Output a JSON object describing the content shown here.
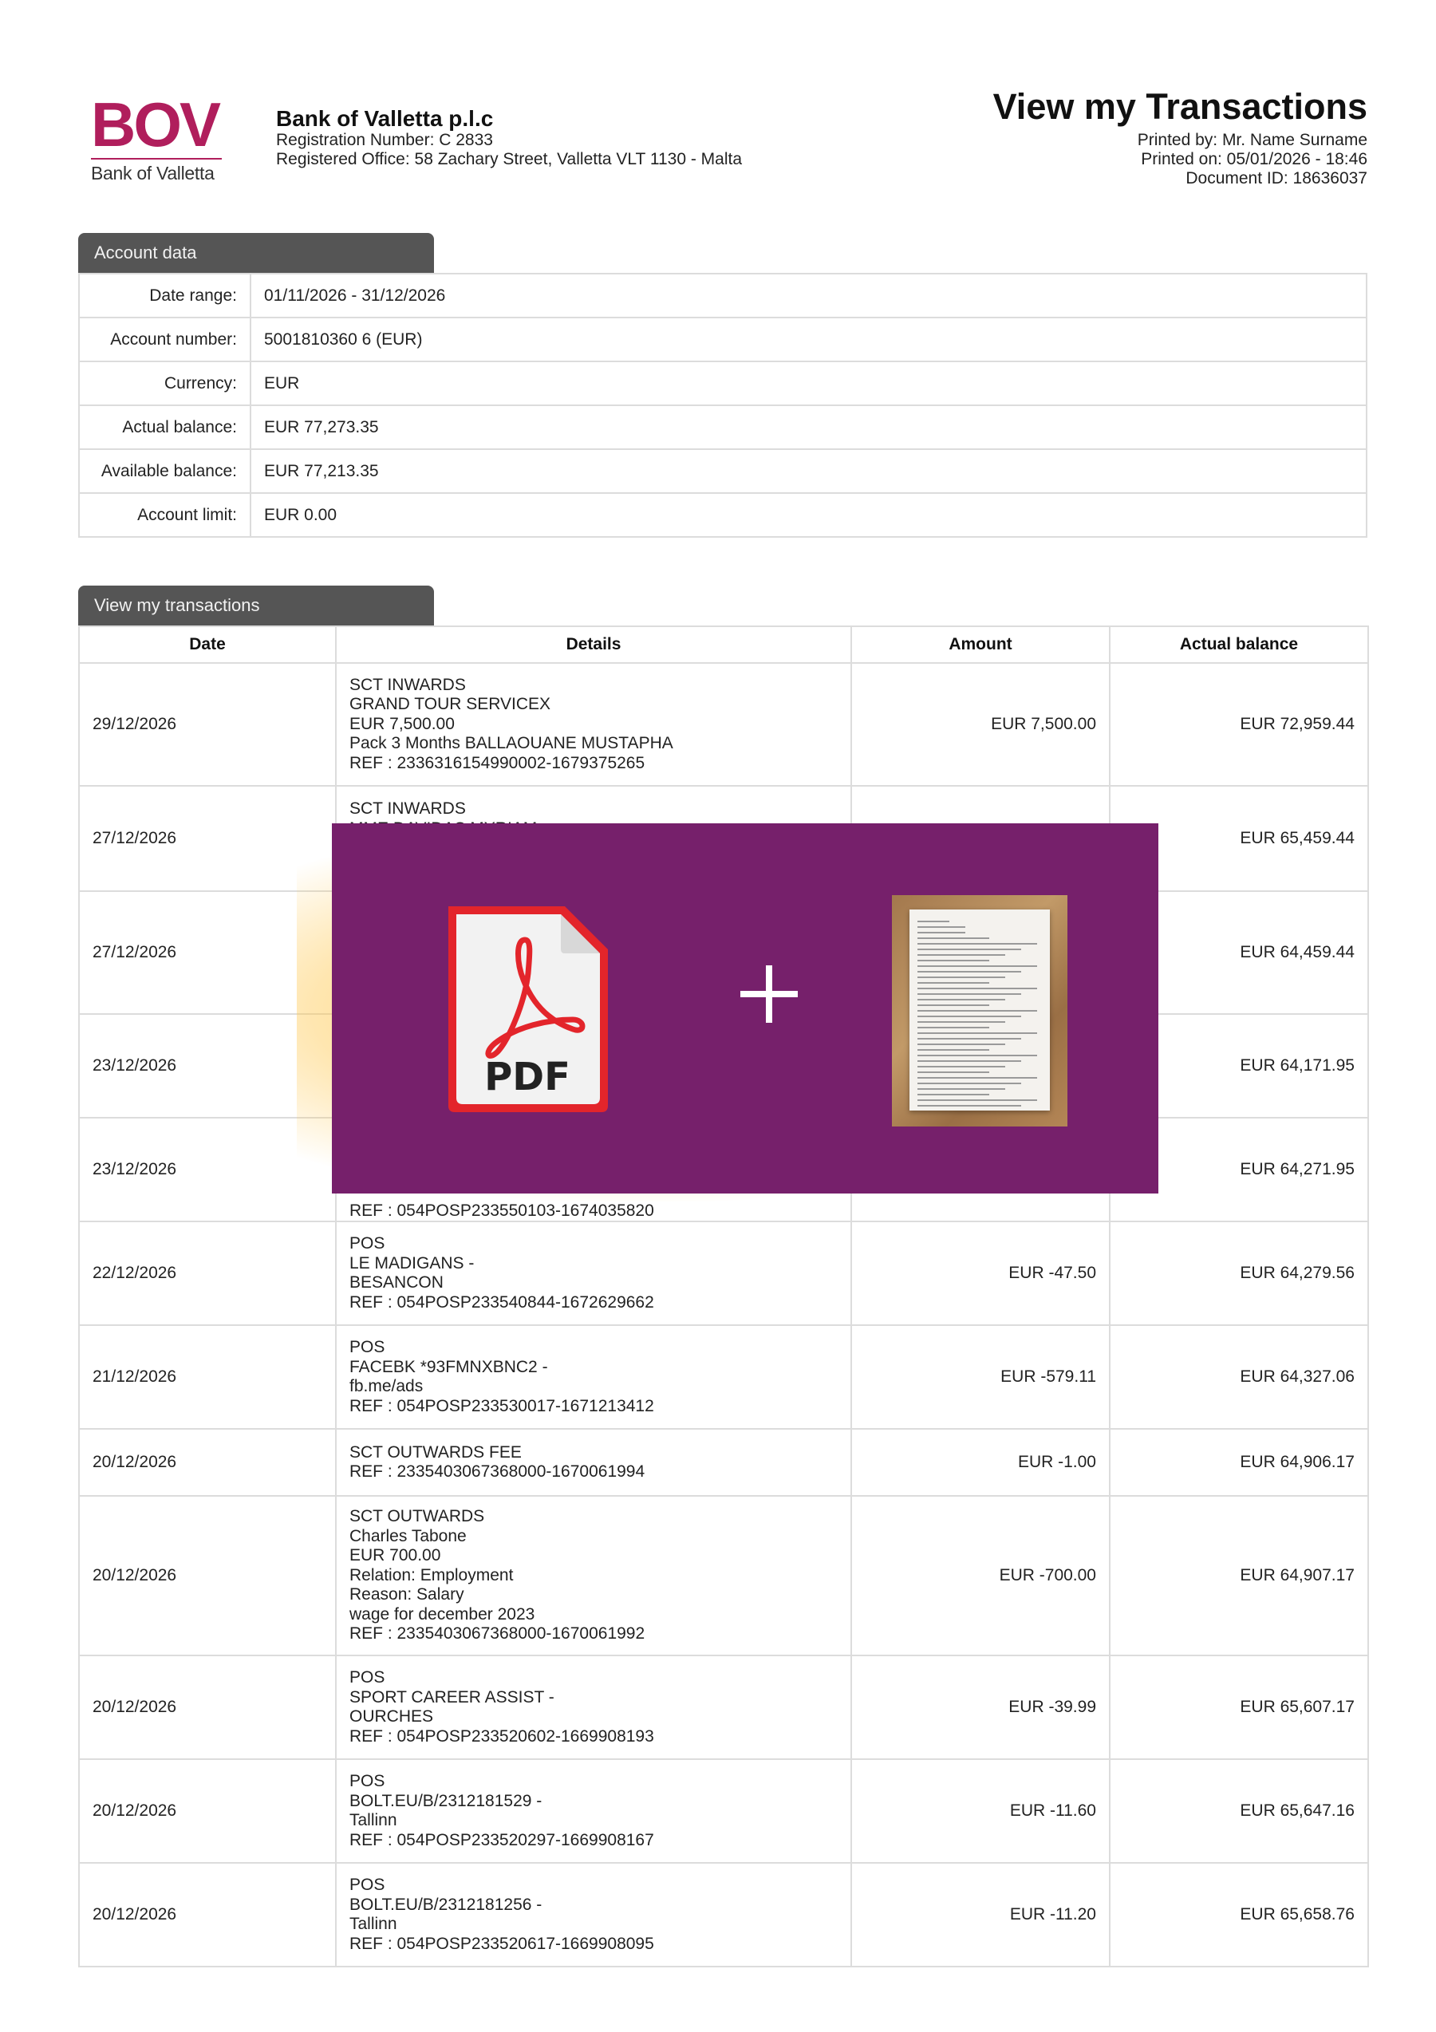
{
  "header": {
    "logo_text": "BOV",
    "logo_subtitle": "Bank of Valletta",
    "bank_name": "Bank of Valletta p.l.c",
    "registration": "Registration Number: C 2833",
    "office": "Registered Office: 58 Zachary Street, Valletta VLT 1130 - Malta",
    "title": "View my Transactions",
    "printed_by": "Printed by: Mr. Name Surname",
    "printed_on": "Printed on: 05/01/2026 - 18:46",
    "document_id": "Document ID: 18636037"
  },
  "account": {
    "tab_label": "Account data",
    "rows": [
      {
        "label": "Date range:",
        "value": "01/11/2026 - 31/12/2026"
      },
      {
        "label": "Account number:",
        "value": "5001810360 6 (EUR)"
      },
      {
        "label": "Currency:",
        "value": "EUR"
      },
      {
        "label": "Actual balance:",
        "value": "EUR 77,273.35"
      },
      {
        "label": "Available balance:",
        "value": "EUR 77,213.35"
      },
      {
        "label": "Account limit:",
        "value": "EUR 0.00"
      }
    ]
  },
  "transactions": {
    "tab_label": "View my transactions",
    "headers": {
      "date": "Date",
      "details": "Details",
      "amount": "Amount",
      "balance": "Actual balance"
    },
    "rows": [
      {
        "date": "29/12/2026",
        "details": [
          "SCT INWARDS",
          "GRAND TOUR SERVICEX",
          "EUR 7,500.00",
          "Pack 3 Months BALLAOUANE MUSTAPHA",
          "REF : 2336316154990002-1679375265"
        ],
        "amount": "EUR 7,500.00",
        "balance": "EUR 72,959.44"
      },
      {
        "date": "27/12/2026",
        "details": [
          "SCT INWARDS",
          "MME DAVIDAS MYRIAM"
        ],
        "amount": "",
        "balance": "EUR 65,459.44"
      },
      {
        "date": "27/12/2026",
        "details": [],
        "amount": "",
        "balance": "EUR 64,459.44"
      },
      {
        "date": "23/12/2026",
        "details": [],
        "amount": "",
        "balance": "EUR 64,171.95"
      },
      {
        "date": "23/12/2026",
        "details": [
          "REF : 054POSP233550103-1674035820"
        ],
        "amount": "",
        "balance": "EUR 64,271.95"
      },
      {
        "date": "22/12/2026",
        "details": [
          "POS",
          "LE MADIGANS -",
          "BESANCON",
          "REF : 054POSP233540844-1672629662"
        ],
        "amount": "EUR -47.50",
        "balance": "EUR 64,279.56"
      },
      {
        "date": "21/12/2026",
        "details": [
          "POS",
          "FACEBK *93FMNXBNC2 -",
          "fb.me/ads",
          "REF : 054POSP233530017-1671213412"
        ],
        "amount": "EUR -579.11",
        "balance": "EUR 64,327.06"
      },
      {
        "date": "20/12/2026",
        "details": [
          "SCT OUTWARDS FEE",
          "REF : 2335403067368000-1670061994"
        ],
        "amount": "EUR -1.00",
        "balance": "EUR 64,906.17"
      },
      {
        "date": "20/12/2026",
        "details": [
          "SCT OUTWARDS",
          "Charles Tabone",
          "EUR 700.00",
          "Relation: Employment",
          "Reason: Salary",
          "wage for december 2023",
          "REF : 2335403067368000-1670061992"
        ],
        "amount": "EUR -700.00",
        "balance": "EUR 64,907.17"
      },
      {
        "date": "20/12/2026",
        "details": [
          "POS",
          "SPORT CAREER ASSIST -",
          "OURCHES",
          "REF : 054POSP233520602-1669908193"
        ],
        "amount": "EUR -39.99",
        "balance": "EUR 65,607.17"
      },
      {
        "date": "20/12/2026",
        "details": [
          "POS",
          "BOLT.EU/B/2312181529 -",
          "Tallinn",
          "REF : 054POSP233520297-1669908167"
        ],
        "amount": "EUR -11.60",
        "balance": "EUR 65,647.16"
      },
      {
        "date": "20/12/2026",
        "details": [
          "POS",
          "BOLT.EU/B/2312181256 -",
          "Tallinn",
          "REF : 054POSP233520617-1669908095"
        ],
        "amount": "EUR -11.20",
        "balance": "EUR 65,658.76"
      }
    ]
  },
  "overlay": {
    "pdf_label": "PDF",
    "pdf_icon": "acrobat-pdf-icon",
    "plus_icon": "plus-icon",
    "thumbnail": "document-photo-thumbnail",
    "background_color": "#76206b",
    "glow_color": "#ffb928"
  },
  "colors": {
    "brand": "#b01e5c",
    "tab": "#555555",
    "border": "#dcdcdc"
  }
}
